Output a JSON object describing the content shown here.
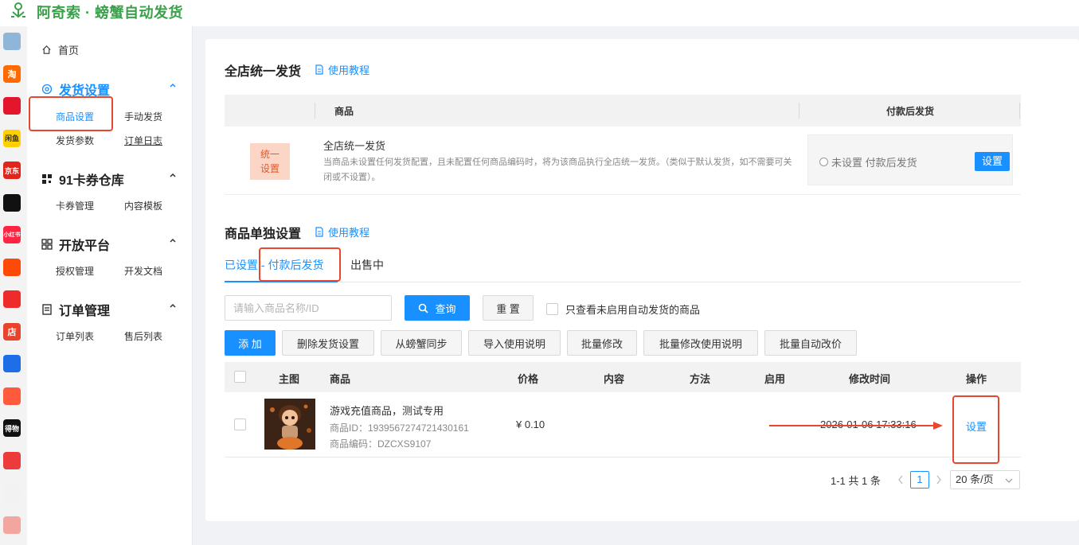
{
  "app": {
    "title": "阿奇索 · 螃蟹自动发货"
  },
  "rail": {
    "items": [
      {
        "icon": "apps-grid-icon",
        "color": "#8fb6d8",
        "text": ""
      },
      {
        "icon": "taobao-icon",
        "color": "#ff6a00",
        "text": "淘"
      },
      {
        "icon": "tmall-icon",
        "color": "#e4162d",
        "text": ""
      },
      {
        "icon": "xianyu-icon",
        "color": "#ffd000",
        "text": "闲鱼"
      },
      {
        "icon": "jd-icon",
        "color": "#e1251b",
        "text": "京东"
      },
      {
        "icon": "douyin-icon",
        "color": "#111111",
        "text": ""
      },
      {
        "icon": "xiaohongshu-icon",
        "color": "#ff2442",
        "text": "小红书"
      },
      {
        "icon": "kuaishou-icon",
        "color": "#ff4906",
        "text": ""
      },
      {
        "icon": "thumbs-up-icon",
        "color": "#ee2b2b",
        "text": ""
      },
      {
        "icon": "shop-icon",
        "color": "#e8432c",
        "text": "店"
      },
      {
        "icon": "link-icon",
        "color": "#1e6ee8",
        "text": ""
      },
      {
        "icon": "chat-icon",
        "color": "#ff5a3c",
        "text": ""
      },
      {
        "icon": "dewu-icon",
        "color": "#111111",
        "text": "得物"
      },
      {
        "icon": "play-icon",
        "color": "#ec3b3b",
        "text": ""
      },
      {
        "icon": "crab-mascot-icon",
        "color": "#f2f2f2",
        "text": ""
      },
      {
        "icon": "clipboard-icon",
        "color": "#f3a6a0",
        "text": ""
      }
    ]
  },
  "sidebar": {
    "home": "首页",
    "groups": [
      {
        "title": "发货设置",
        "items": [
          "商品设置",
          "手动发货",
          "发货参数",
          "订单日志"
        ]
      },
      {
        "title": "91卡券仓库",
        "items": [
          "卡券管理",
          "内容模板"
        ]
      },
      {
        "title": "开放平台",
        "items": [
          "授权管理",
          "开发文档"
        ]
      },
      {
        "title": "订单管理",
        "items": [
          "订单列表",
          "售后列表"
        ]
      }
    ]
  },
  "store_wide": {
    "title": "全店统一发货",
    "tutorial": "使用教程",
    "columns": [
      "商品",
      "付款后发货"
    ],
    "row": {
      "tag": "统一\n设置",
      "name": "全店统一发货",
      "desc": "当商品未设置任何发货配置，且未配置任何商品编码时，将为该商品执行全店统一发货。（类似于默认发货，如不需要可关闭或不设置）。",
      "radio_label": "未设置 付款后发货",
      "button": "设置"
    }
  },
  "product_settings": {
    "title": "商品单独设置",
    "tutorial": "使用教程",
    "tabs": [
      "已设置 - 付款后发货",
      "出售中"
    ],
    "search_placeholder": "请输入商品名称/ID",
    "search_value": "",
    "query_button": "查询",
    "reset_button": "重 置",
    "only_unenabled_label": "只查看未启用自动发货的商品",
    "actions": [
      "添 加",
      "删除发货设置",
      "从螃蟹同步",
      "导入使用说明",
      "批量修改",
      "批量修改使用说明",
      "批量自动改价"
    ],
    "columns": [
      "主图",
      "商品",
      "价格",
      "内容",
      "方法",
      "启用",
      "修改时间",
      "操作"
    ],
    "rows": [
      {
        "name": "游戏充值商品，测试专用",
        "id_line": "商品ID：1939567274721430161",
        "code_line": "商品编码：DZCXS9107",
        "price": "¥ 0.10",
        "content": "",
        "method": "",
        "enabled": "",
        "modified": "2026-01-06 17:33:16",
        "action": "设置"
      }
    ],
    "pagination": {
      "summary": "1-1 共 1 条",
      "current_page": "1",
      "page_size": "20 条/页"
    }
  },
  "colors": {
    "primary": "#1890ff",
    "brand": "#3aa14a",
    "highlight": "#e8472e",
    "tag_bg": "#fbd5c5",
    "tag_text": "#e05a2b"
  }
}
